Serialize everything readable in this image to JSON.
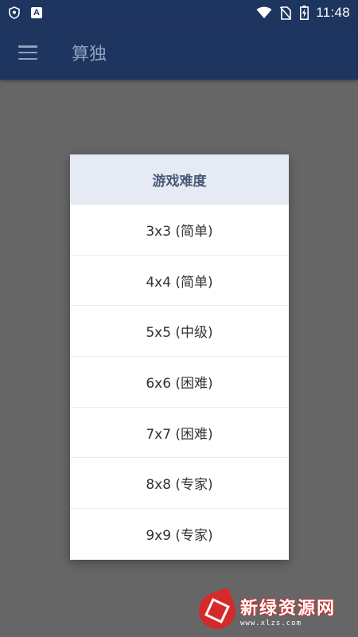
{
  "status_bar": {
    "time": "11:48",
    "left_icons": [
      "shield-icon",
      "app-a-icon"
    ],
    "right_icons": [
      "wifi-icon",
      "no-sim-icon",
      "battery-charging-icon"
    ],
    "app_a_letter": "A"
  },
  "app_bar": {
    "title": "算独",
    "menu_icon": "hamburger-menu-icon"
  },
  "dialog": {
    "title": "游戏难度",
    "options": [
      {
        "label": "3x3 (简单)"
      },
      {
        "label": "4x4 (简单)"
      },
      {
        "label": "5x5 (中级)"
      },
      {
        "label": "6x6 (困难)"
      },
      {
        "label": "7x7 (困难)"
      },
      {
        "label": "8x8 (专家)"
      },
      {
        "label": "9x9 (专家)"
      }
    ]
  },
  "watermark": {
    "text": "新绿资源网",
    "url": "www.xlzs.com"
  },
  "colors": {
    "primary": "#1e3560",
    "scrim": "#666666",
    "dialog_header_bg": "#e6eaf2",
    "watermark_red": "#d42a2a"
  }
}
